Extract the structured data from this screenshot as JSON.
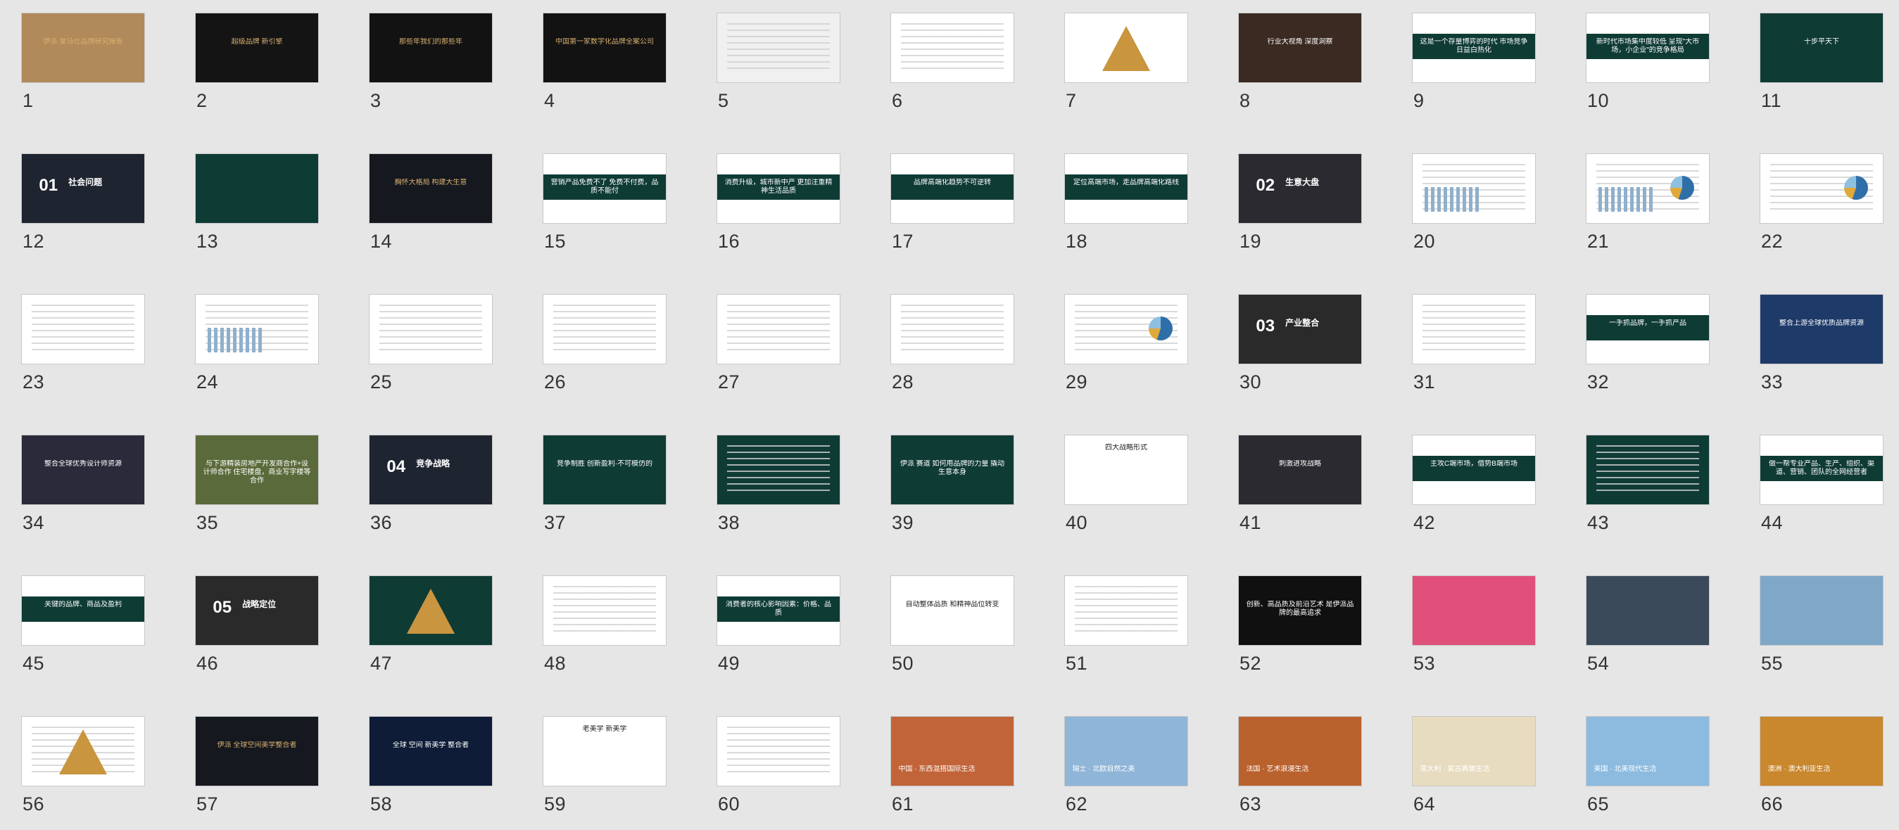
{
  "panel": "slide-sorter",
  "slides": [
    {
      "n": "1",
      "bg": "#b08a5a",
      "text": "伊派·爱马仕品牌研究报告",
      "style": "gold"
    },
    {
      "n": "2",
      "bg": "#141414",
      "text": "超级品牌 新引擎",
      "style": "gold"
    },
    {
      "n": "3",
      "bg": "#121212",
      "text": "那些年我们的那些年",
      "style": "darkgold"
    },
    {
      "n": "4",
      "bg": "#121212",
      "text": "中国第一家数字化品牌全案公司",
      "style": "darkgold"
    },
    {
      "n": "5",
      "bg": "#f0f0f0",
      "text": "",
      "style": "logos"
    },
    {
      "n": "6",
      "bg": "#ffffff",
      "text": "",
      "style": "diagram"
    },
    {
      "n": "7",
      "bg": "#ffffff",
      "text": "",
      "style": "pyramid"
    },
    {
      "n": "8",
      "bg": "#3a2a22",
      "text": "行业大视角 深度洞察",
      "style": "photodark"
    },
    {
      "n": "9",
      "bg": "#ffffff",
      "text": "这是一个存量博弈的时代 市场竞争日益白热化",
      "style": "band"
    },
    {
      "n": "10",
      "bg": "#ffffff",
      "text": "新时代市场集中度较低 呈现\"大市场，小企业\"的竞争格局",
      "style": "band"
    },
    {
      "n": "11",
      "bg": "#0f3b35",
      "text": "十步平天下",
      "style": "green"
    },
    {
      "n": "12",
      "bg": "#1e2430",
      "text": "社会问题",
      "num": "01",
      "style": "chapter"
    },
    {
      "n": "13",
      "bg": "#0f3b35",
      "text": "",
      "style": "greenphoto"
    },
    {
      "n": "14",
      "bg": "#15181f",
      "text": "胸怀大格局 构建大生意",
      "style": "darkgold"
    },
    {
      "n": "15",
      "bg": "#ffffff",
      "text": "营销产品免费不了 免费不付费，品质不能付",
      "style": "band"
    },
    {
      "n": "16",
      "bg": "#ffffff",
      "text": "消费升级，城市新中产 更加注重精神生活品质",
      "style": "band"
    },
    {
      "n": "17",
      "bg": "#ffffff",
      "text": "品牌高端化趋势不可逆转",
      "style": "band"
    },
    {
      "n": "18",
      "bg": "#ffffff",
      "text": "定位高端市场，走品牌高端化路线",
      "style": "band"
    },
    {
      "n": "19",
      "bg": "#2a2a30",
      "text": "生意大盘",
      "num": "02",
      "style": "chapter"
    },
    {
      "n": "20",
      "bg": "#ffffff",
      "text": "",
      "style": "barchart"
    },
    {
      "n": "21",
      "bg": "#ffffff",
      "text": "",
      "style": "barpie"
    },
    {
      "n": "22",
      "bg": "#ffffff",
      "text": "",
      "style": "pies"
    },
    {
      "n": "23",
      "bg": "#ffffff",
      "text": "",
      "style": "chartred"
    },
    {
      "n": "24",
      "bg": "#ffffff",
      "text": "",
      "style": "barchart"
    },
    {
      "n": "25",
      "bg": "#ffffff",
      "text": "",
      "style": "textimg"
    },
    {
      "n": "26",
      "bg": "#ffffff",
      "text": "",
      "style": "textimg"
    },
    {
      "n": "27",
      "bg": "#ffffff",
      "text": "",
      "style": "textred"
    },
    {
      "n": "28",
      "bg": "#ffffff",
      "text": "",
      "style": "textimg"
    },
    {
      "n": "29",
      "bg": "#ffffff",
      "text": "",
      "style": "textpie"
    },
    {
      "n": "30",
      "bg": "#2a2a2a",
      "text": "产业整合",
      "num": "03",
      "style": "chapter"
    },
    {
      "n": "31",
      "bg": "#ffffff",
      "text": "",
      "style": "flow"
    },
    {
      "n": "32",
      "bg": "#ffffff",
      "text": "一手抓品牌，一手抓产品",
      "style": "band"
    },
    {
      "n": "33",
      "bg": "#1e3a68",
      "text": "整合上游全球优质品牌资源",
      "style": "map"
    },
    {
      "n": "34",
      "bg": "#2a2a3a",
      "text": "整合全球优秀设计师资源",
      "style": "faces"
    },
    {
      "n": "35",
      "bg": "#5a6a3a",
      "text": "与下游精装房地产开发商合作+设计师合作 住宅楼盘，商业写字楼等合作",
      "style": "crowd"
    },
    {
      "n": "36",
      "bg": "#1e2430",
      "text": "竞争战略",
      "num": "04",
      "style": "chapter"
    },
    {
      "n": "37",
      "bg": "#0f3b35",
      "text": "竞争制胜 创新盈利·不可模仿的",
      "style": "greenphoto"
    },
    {
      "n": "38",
      "bg": "#0f3b35",
      "text": "",
      "style": "greentext"
    },
    {
      "n": "39",
      "bg": "#0f3b35",
      "text": "伊派 赛道 如何用品牌的力量 撬动生意本身",
      "style": "green"
    },
    {
      "n": "40",
      "bg": "#ffffff",
      "text": "四大战略形式",
      "style": "boxes"
    },
    {
      "n": "41",
      "bg": "#2a2a30",
      "text": "刺激进攻战略",
      "style": "photodark"
    },
    {
      "n": "42",
      "bg": "#ffffff",
      "text": "主攻C端市场，借势B端市场",
      "style": "band"
    },
    {
      "n": "43",
      "bg": "#0f3b35",
      "text": "",
      "style": "greenboxes"
    },
    {
      "n": "44",
      "bg": "#ffffff",
      "text": "做一帮专业产品、生产、组织、渠道、营销、团队的全网经营者",
      "style": "band"
    },
    {
      "n": "45",
      "bg": "#ffffff",
      "text": "关键的品牌、商品及盈利",
      "style": "band"
    },
    {
      "n": "46",
      "bg": "#2a2a2a",
      "text": "战略定位",
      "num": "05",
      "style": "chapter"
    },
    {
      "n": "47",
      "bg": "#0f3b35",
      "text": "",
      "style": "greenpyr"
    },
    {
      "n": "48",
      "bg": "#ffffff",
      "text": "",
      "style": "table"
    },
    {
      "n": "49",
      "bg": "#ffffff",
      "text": "消费者的核心影响因素：价格、品质",
      "style": "band"
    },
    {
      "n": "50",
      "bg": "#ffffff",
      "text": "自动整体品质 和精神品位转变",
      "style": "textblue"
    },
    {
      "n": "51",
      "bg": "#ffffff",
      "text": "",
      "style": "greenboxes2"
    },
    {
      "n": "52",
      "bg": "#101010",
      "text": "创新、高品质及前沿艺术 是伊派品牌的最高追求",
      "style": "photodark"
    },
    {
      "n": "53",
      "bg": "#e0507a",
      "text": "",
      "style": "art"
    },
    {
      "n": "54",
      "bg": "#3a4a5a",
      "text": "",
      "style": "sea"
    },
    {
      "n": "55",
      "bg": "#7fa8c8",
      "text": "",
      "style": "sea"
    },
    {
      "n": "56",
      "bg": "#ffffff",
      "text": "",
      "style": "pyrs"
    },
    {
      "n": "57",
      "bg": "#15181f",
      "text": "伊派 全球空间美学整合者",
      "style": "darkgold"
    },
    {
      "n": "58",
      "bg": "#0e1c38",
      "text": "全球 空间 新美学 整合者",
      "style": "earth"
    },
    {
      "n": "59",
      "bg": "#ffffff",
      "text": "老美学 新美学",
      "style": "logo"
    },
    {
      "n": "60",
      "bg": "#ffffff",
      "text": "",
      "style": "ring"
    },
    {
      "n": "61",
      "bg": "#c2643a",
      "text": "中国 · 东西混搭国际生活",
      "style": "warm"
    },
    {
      "n": "62",
      "bg": "#8fb5d9",
      "text": "瑞士 · 北欧自然之美",
      "style": "lake"
    },
    {
      "n": "63",
      "bg": "#b9622e",
      "text": "法国 · 艺术浪漫生活",
      "style": "paris"
    },
    {
      "n": "64",
      "bg": "#e8dcc0",
      "text": "意大利 · 复古典雅生活",
      "style": "pisa"
    },
    {
      "n": "65",
      "bg": "#8dbbe0",
      "text": "美国 · 北美现代生活",
      "style": "house"
    },
    {
      "n": "66",
      "bg": "#c9872e",
      "text": "澳洲 · 澳大利亚生活",
      "style": "roo"
    }
  ]
}
